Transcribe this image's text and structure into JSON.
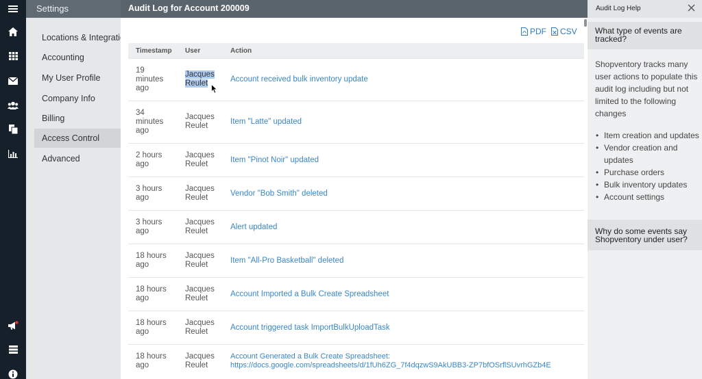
{
  "settings": {
    "title": "Settings",
    "items": [
      {
        "label": "Locations & Integrations"
      },
      {
        "label": "Accounting"
      },
      {
        "label": "My User Profile"
      },
      {
        "label": "Company Info"
      },
      {
        "label": "Billing"
      },
      {
        "label": "Access Control",
        "active": true
      },
      {
        "label": "Advanced"
      }
    ]
  },
  "rail": {
    "icons": [
      "menu-icon",
      "home-icon",
      "grid-icon",
      "mail-icon",
      "users-icon",
      "documents-icon",
      "bar-chart-icon",
      "megaphone-icon",
      "server-icon",
      "info-icon"
    ]
  },
  "modal": {
    "title": "Audit Log for Account 200009",
    "export_pdf": "PDF",
    "export_csv": "CSV",
    "columns": {
      "timestamp": "Timestamp",
      "user": "User",
      "action": "Action"
    },
    "rows": [
      {
        "ts1": "19",
        "ts2": "minutes",
        "ts3": "ago",
        "user1": "Jacques",
        "user2": "Reulet",
        "action": "Account received bulk inventory update"
      },
      {
        "ts1": "34",
        "ts2": "minutes",
        "ts3": "ago",
        "user1": "Jacques",
        "user2": "Reulet",
        "action": "Item \"Latte\" updated"
      },
      {
        "ts1": "2 hours",
        "ts2": "ago",
        "user1": "Jacques",
        "user2": "Reulet",
        "action": "Item \"Pinot Noir\" updated"
      },
      {
        "ts1": "3 hours",
        "ts2": "ago",
        "user1": "Jacques",
        "user2": "Reulet",
        "action": "Vendor \"Bob Smith\" deleted"
      },
      {
        "ts1": "3 hours",
        "ts2": "ago",
        "user1": "Jacques",
        "user2": "Reulet",
        "action": "Alert updated"
      },
      {
        "ts1": "18 hours",
        "ts2": "ago",
        "user1": "Jacques",
        "user2": "Reulet",
        "action": "Item \"All-Pro Basketball\" deleted"
      },
      {
        "ts1": "18 hours",
        "ts2": "ago",
        "user1": "Jacques",
        "user2": "Reulet",
        "action": "Account Imported a Bulk Create Spreadsheet"
      },
      {
        "ts1": "18 hours",
        "ts2": "ago",
        "user1": "Jacques",
        "user2": "Reulet",
        "action": "Account triggered task ImportBulkUploadTask"
      },
      {
        "ts1": "18 hours",
        "ts2": "ago",
        "user1": "Jacques",
        "user2": "Reulet",
        "action": "Account Generated a Bulk Create Spreadsheet:",
        "action2": "https://docs.google.com/spreadsheets/d/1fUh6ZG_7f4dqzwS9AkUBB3-ZP7bfOSrflSUvrhGZb4E"
      }
    ]
  },
  "help": {
    "title": "Audit Log Help",
    "q1_line1": "What type of events are",
    "q1_line2": "tracked?",
    "body_lines": [
      "Shopventory tracks many",
      "user actions to populate this",
      "audit log including but not",
      "limited to the following",
      "changes"
    ],
    "list": [
      {
        "lines": [
          "Item creation and updates"
        ]
      },
      {
        "lines": [
          "Vendor creation and",
          "updates"
        ]
      },
      {
        "lines": [
          "Purchase orders"
        ]
      },
      {
        "lines": [
          "Bulk inventory updates"
        ]
      },
      {
        "lines": [
          "Account settings"
        ]
      }
    ],
    "q2_line1": "Why do some events say",
    "q2_line2": "Shopventory under user?"
  }
}
